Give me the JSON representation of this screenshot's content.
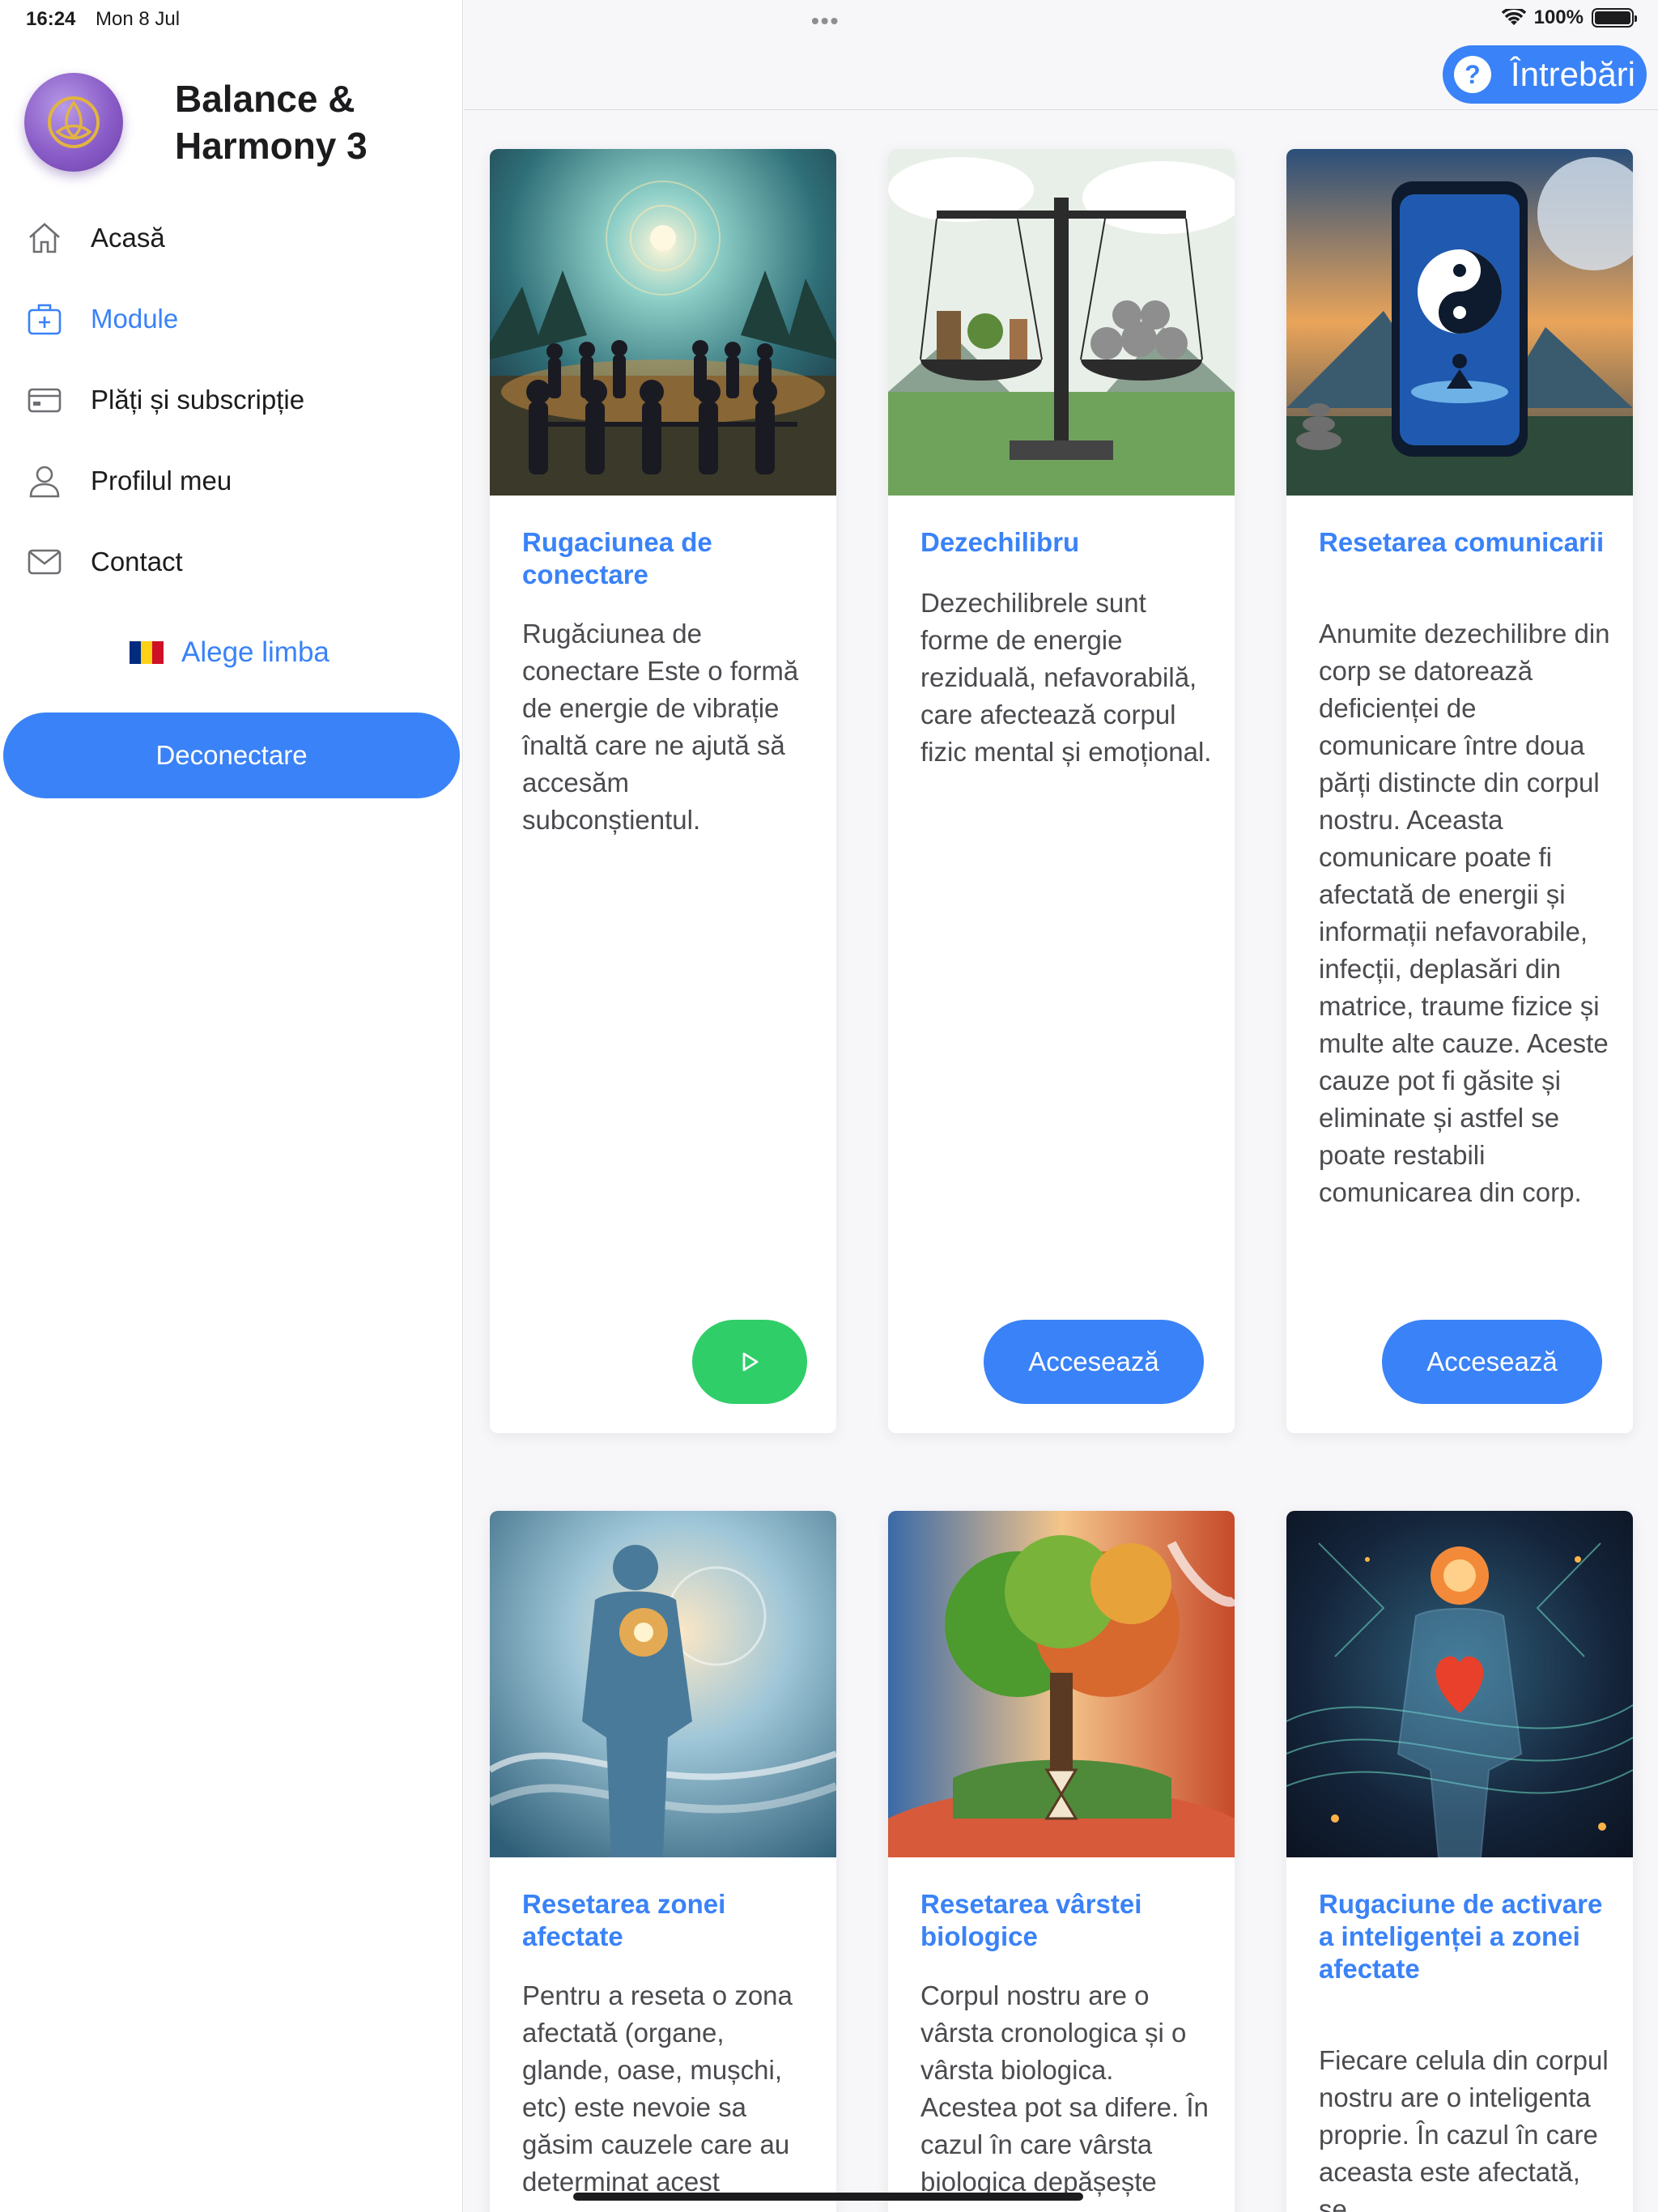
{
  "status_bar": {
    "time": "16:24",
    "date": "Mon 8 Jul",
    "battery": "100%"
  },
  "sidebar": {
    "app_title": "Balance & Harmony 3",
    "items": [
      {
        "label": "Acasă",
        "icon": "home-icon",
        "active": false
      },
      {
        "label": "Module",
        "icon": "module-icon",
        "active": true
      },
      {
        "label": "Plăți și subscripție",
        "icon": "credit-card-icon",
        "active": false
      },
      {
        "label": "Profilul meu",
        "icon": "user-icon",
        "active": false
      },
      {
        "label": "Contact",
        "icon": "envelope-icon",
        "active": false
      }
    ],
    "language_label": "Alege limba",
    "logout_label": "Deconectare"
  },
  "header": {
    "help_label": "Întrebări"
  },
  "cards": [
    {
      "title": "Rugaciunea de conectare",
      "description": "Rugăciunea de conectare Este o formă de energie de vibrație înaltă care ne ajută să accesăm subconștientul.",
      "action": "play"
    },
    {
      "title": "Dezechilibru",
      "description": "Dezechilibrele sunt forme de energie reziduală, nefavorabilă, care afectează corpul fizic mental și emoțional.",
      "action": "Accesează"
    },
    {
      "title": "Resetarea comunicarii",
      "description": "Anumite dezechilibre din corp se datorează deficienței de comunicare între doua părți distincte din corpul nostru. Aceasta comunicare poate fi afectată de energii și informații nefavorabile, infecții, deplasări din matrice, traume fizice și multe alte cauze. Aceste cauze pot fi găsite și eliminate și astfel se poate restabili comunicarea din corp.",
      "action": "Accesează"
    },
    {
      "title": "Resetarea zonei afectate",
      "description": "Pentru a reseta o zona afectată (organe, glande, oase, mușchi, etc) este nevoie sa găsim cauzele care au determinat acest",
      "action": ""
    },
    {
      "title": "Resetarea vârstei biologice",
      "description": "Corpul nostru are o vârsta cronologica și o vârsta biologica. Acestea pot sa difere. În cazul în care vârsta biologica depășește",
      "action": ""
    },
    {
      "title": "Rugaciune de activare a inteligenței a zonei afectate",
      "description": "Fiecare celula din corpul nostru are o inteligenta proprie. În cazul în care aceasta este afectată, se",
      "action": ""
    }
  ],
  "colors": {
    "accent": "#3a82f7",
    "play": "#2fce69"
  }
}
